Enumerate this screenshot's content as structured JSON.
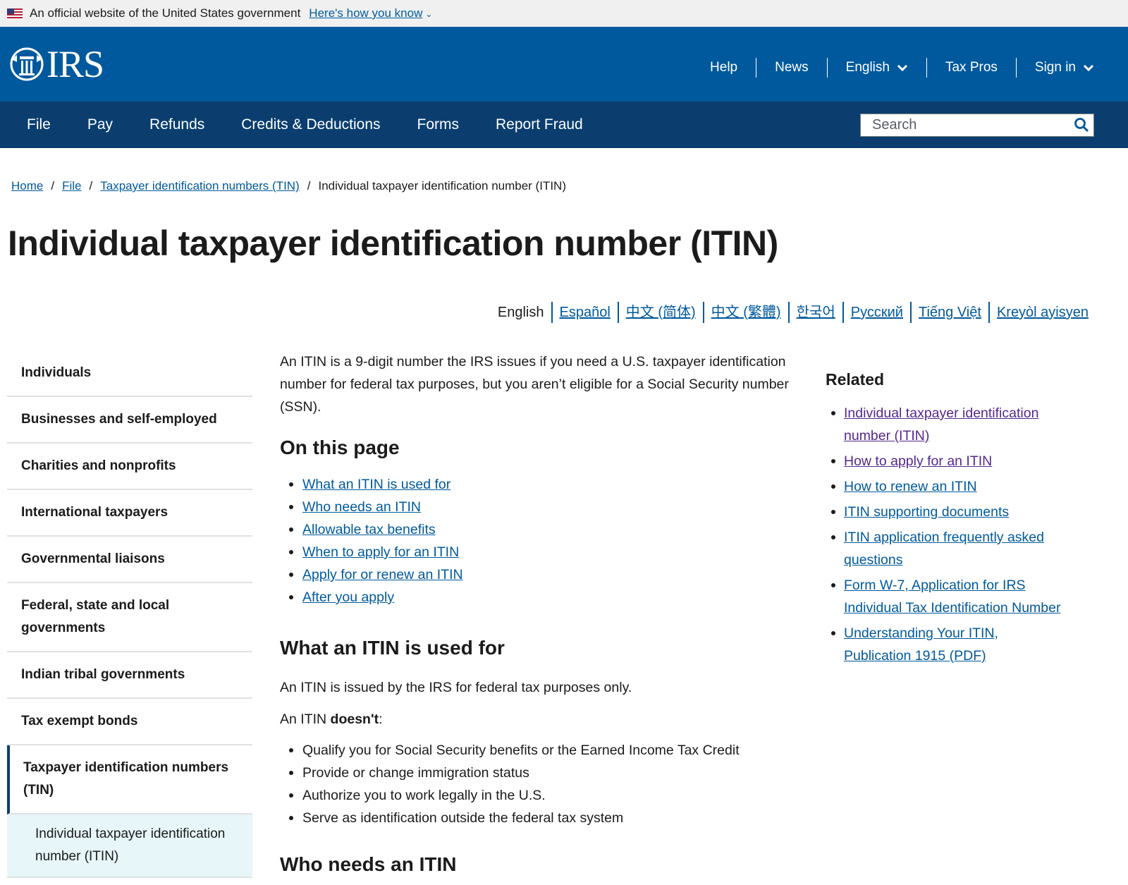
{
  "gov_banner": {
    "text": "An official website of the United States government",
    "link": "Here's how you know"
  },
  "header": {
    "logo_text": "IRS",
    "utility": [
      {
        "label": "Help",
        "dropdown": false
      },
      {
        "label": "News",
        "dropdown": false
      },
      {
        "label": "English",
        "dropdown": true
      },
      {
        "label": "Tax Pros",
        "dropdown": false
      },
      {
        "label": "Sign in",
        "dropdown": true
      }
    ]
  },
  "nav": {
    "items": [
      "File",
      "Pay",
      "Refunds",
      "Credits & Deductions",
      "Forms",
      "Report Fraud"
    ],
    "search_placeholder": "Search"
  },
  "breadcrumb": {
    "links": [
      "Home",
      "File",
      "Taxpayer identification numbers (TIN)"
    ],
    "current": "Individual taxpayer identification number (ITIN)"
  },
  "page_title": "Individual taxpayer identification number (ITIN)",
  "languages": {
    "current": "English",
    "links": [
      "Español",
      "中文 (简体)",
      "中文 (繁體)",
      "한국어",
      "Русский",
      "Tiếng Việt",
      "Kreyòl ayisyen"
    ]
  },
  "sidebar": {
    "items": [
      "Individuals",
      "Businesses and self-employed",
      "Charities and nonprofits",
      "International taxpayers",
      "Governmental liaisons",
      "Federal, state and local governments",
      "Indian tribal governments",
      "Tax exempt bonds"
    ],
    "active": "Taxpayer identification numbers (TIN)",
    "sub_active": "Individual taxpayer identification number (ITIN)"
  },
  "content": {
    "intro": "An ITIN is a 9-digit number the IRS issues if you need a U.S. taxpayer identification number for federal tax purposes, but you aren’t eligible for a Social Security number (SSN).",
    "on_this_page_heading": "On this page",
    "on_this_page": [
      "What an ITIN is used for",
      "Who needs an ITIN",
      "Allowable tax benefits",
      "When to apply for an ITIN",
      "Apply for or renew an ITIN",
      "After you apply"
    ],
    "section1_heading": "What an ITIN is used for",
    "section1_p": "An ITIN is issued by the IRS for federal tax purposes only.",
    "doesnt_prefix": "An ITIN ",
    "doesnt_bold": "doesn't",
    "doesnt_suffix": ":",
    "doesnt_list": [
      "Qualify you for Social Security benefits or the Earned Income Tax Credit",
      "Provide or change immigration status",
      "Authorize you to work legally in the U.S.",
      "Serve as identification outside the federal tax system"
    ],
    "section2_heading": "Who needs an ITIN"
  },
  "related": {
    "heading": "Related",
    "links": [
      {
        "label": "Individual taxpayer identification number (ITIN)",
        "visited": true
      },
      {
        "label": "How to apply for an ITIN",
        "visited": true
      },
      {
        "label": "How to renew an ITIN",
        "visited": false
      },
      {
        "label": "ITIN supporting documents",
        "visited": false
      },
      {
        "label": "ITIN application frequently asked questions",
        "visited": false
      },
      {
        "label": "Form W-7, Application for IRS Individual Tax Identification Number",
        "visited": false
      },
      {
        "label": "Understanding Your ITIN, Publication 1915 (PDF)",
        "visited": false
      }
    ]
  },
  "colors": {
    "header_blue": "#00599c",
    "nav_navy": "#0b3e6f",
    "link": "#00599c",
    "visited_link": "#54278f",
    "active_sub_bg": "#e7f6f8"
  }
}
